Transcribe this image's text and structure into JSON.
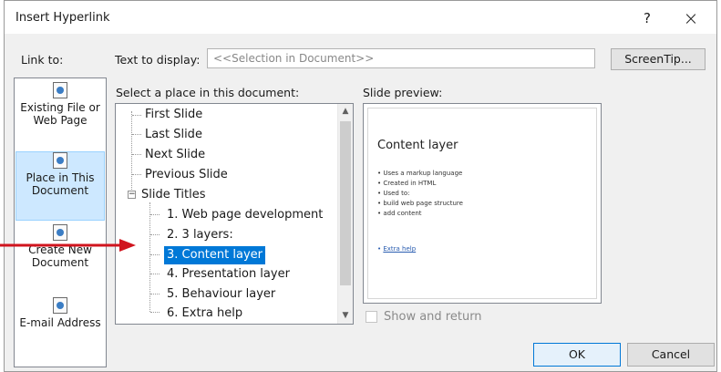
{
  "dialog": {
    "title": "Insert Hyperlink",
    "help_label": "?",
    "close_label": "×"
  },
  "link_to": {
    "label": "Link to:",
    "items": [
      {
        "label": "Existing File or Web Page",
        "icon": "document-globe-icon",
        "selected": false
      },
      {
        "label": "Place in This Document",
        "icon": "document-place-icon",
        "selected": true
      },
      {
        "label": "Create New Document",
        "icon": "new-document-icon",
        "selected": false
      },
      {
        "label": "E-mail Address",
        "icon": "email-icon",
        "selected": false
      }
    ]
  },
  "text_to_display": {
    "label": "Text to display:",
    "value": "<<Selection in Document>>"
  },
  "screentip_label": "ScreenTip...",
  "place_list": {
    "label": "Select a place in this document:",
    "items": [
      {
        "label": "First Slide",
        "level": 0
      },
      {
        "label": "Last Slide",
        "level": 0
      },
      {
        "label": "Next Slide",
        "level": 0
      },
      {
        "label": "Previous Slide",
        "level": 0
      },
      {
        "label": "Slide Titles",
        "level": 0,
        "expanded": true
      },
      {
        "label": "1. Web page development",
        "level": 1
      },
      {
        "label": "2. 3 layers:",
        "level": 1
      },
      {
        "label": "3. Content layer",
        "level": 1,
        "selected": true
      },
      {
        "label": "4. Presentation layer",
        "level": 1
      },
      {
        "label": "5. Behaviour layer",
        "level": 1
      },
      {
        "label": "6. Extra help",
        "level": 1
      }
    ]
  },
  "preview": {
    "label": "Slide preview:",
    "slide_title": "Content layer",
    "bullets": [
      "• Uses a markup language",
      "• Created in HTML",
      "• Used to:",
      "• build web page structure",
      "• add content"
    ],
    "link_prefix": "• ",
    "link_text": "Extra help"
  },
  "show_and_return": {
    "label": "Show and return",
    "checked": false
  },
  "ok_label": "OK",
  "cancel_label": "Cancel",
  "annotation": {
    "arrow_color": "#d0141e"
  }
}
